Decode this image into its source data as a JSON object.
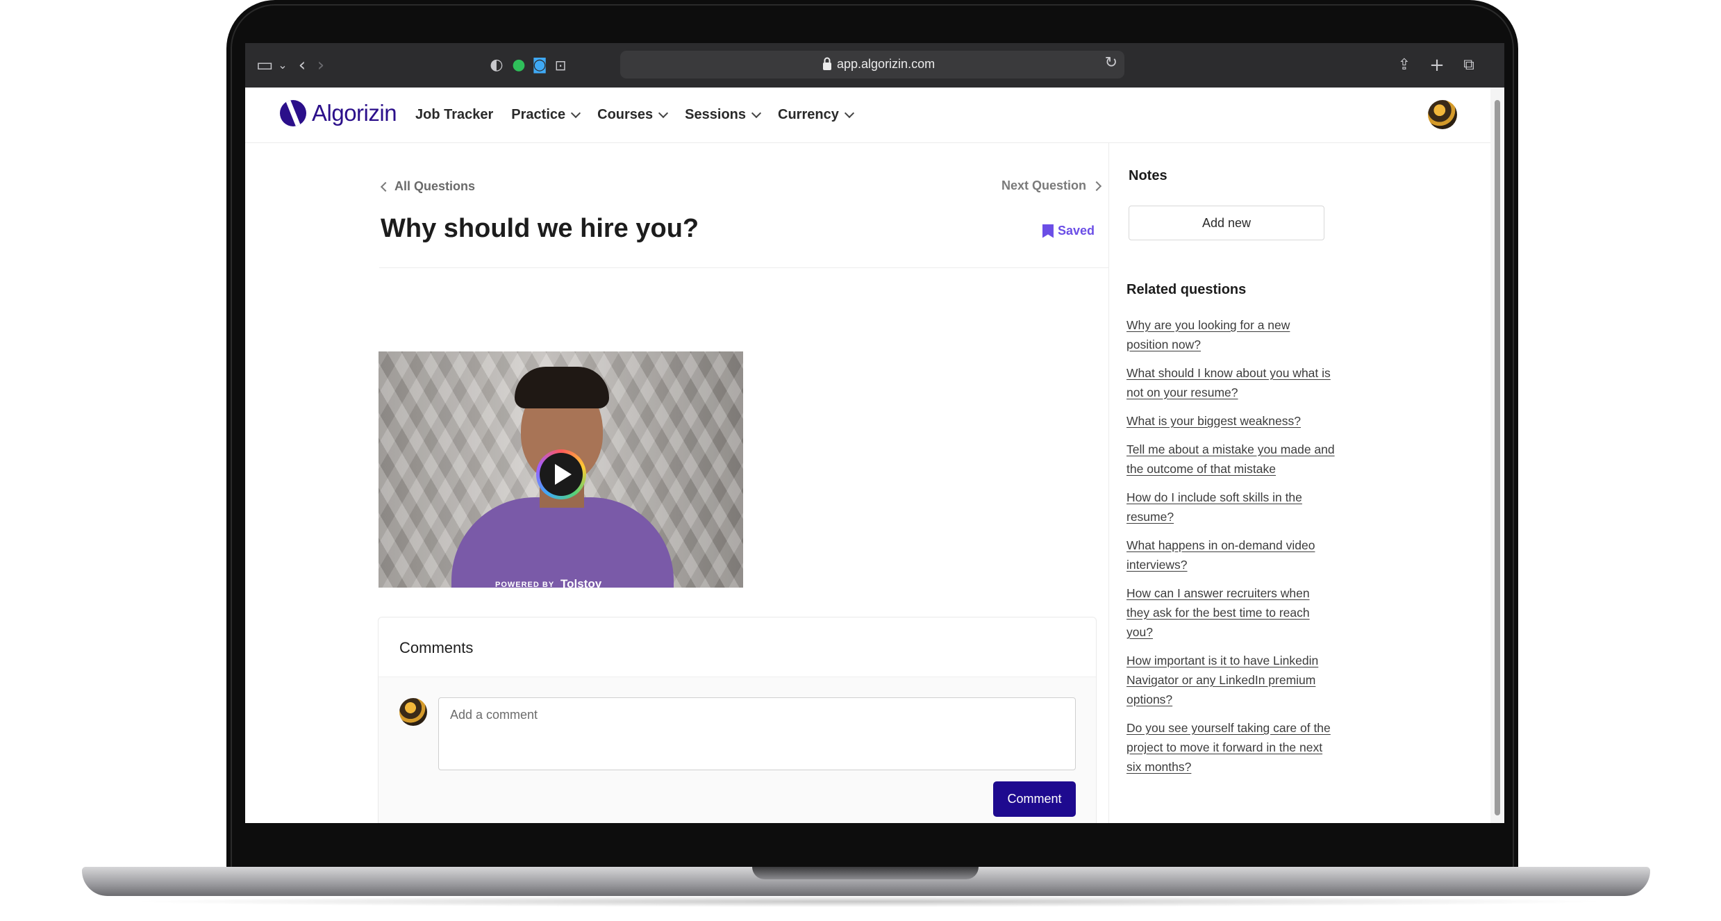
{
  "browser": {
    "url": "app.algorizin.com"
  },
  "app": {
    "logo_text": "Algorizin",
    "nav": [
      {
        "label": "Job Tracker"
      },
      {
        "label": "Practice"
      },
      {
        "label": "Courses"
      },
      {
        "label": "Sessions"
      },
      {
        "label": "Currency"
      }
    ]
  },
  "question": {
    "back_label": "All Questions",
    "next_label": "Next Question",
    "title": "Why should we hire you?",
    "saved_label": "Saved"
  },
  "video": {
    "powered_label": "POWERED BY",
    "brand_label": "Tolstoy"
  },
  "comments": {
    "title": "Comments",
    "placeholder": "Add a comment",
    "submit_label": "Comment"
  },
  "sidebar": {
    "notes_title": "Notes",
    "add_new_label": "Add new",
    "related_title": "Related questions",
    "related": [
      "Why are you looking for a new position now?",
      "What should I know about you what is not on your resume?",
      "What is your biggest weakness?",
      "Tell me about a mistake you made and the outcome of that mistake",
      "How do I include soft skills in the resume?",
      "What happens in on-demand video interviews?",
      "How can I answer recruiters when they ask for the best time to reach you?",
      "How important is it to have Linkedin Navigator or any LinkedIn premium options?",
      "Do you see yourself taking care of the project to move it forward in the next six months?"
    ]
  },
  "colors": {
    "brand": "#2b0f8a",
    "accent": "#6b4ee6",
    "button": "#1e0a8f"
  }
}
